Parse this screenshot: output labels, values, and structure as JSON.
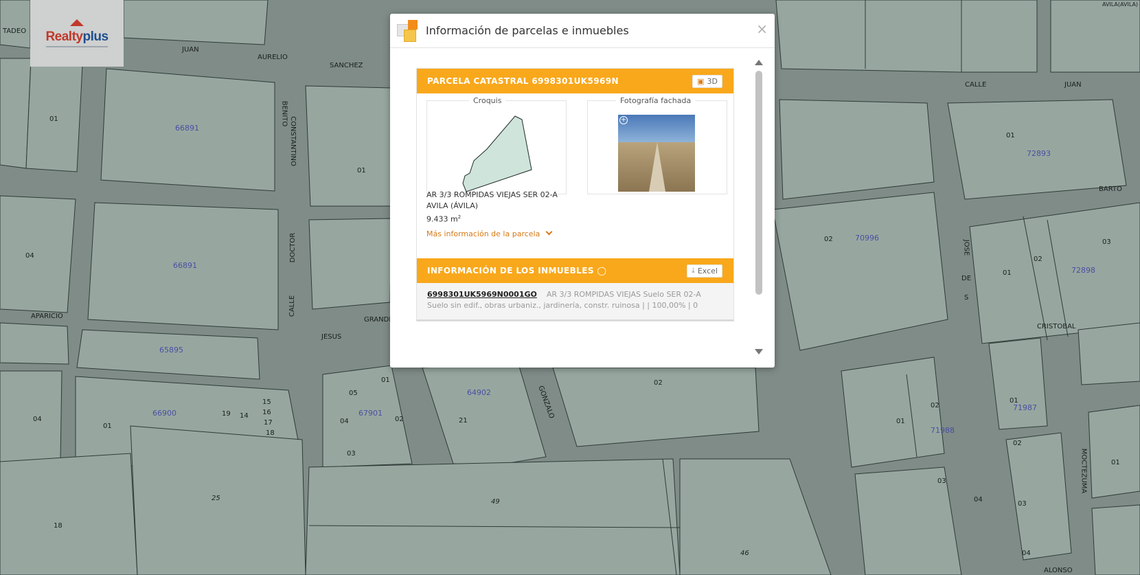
{
  "logo": {
    "brand_part1": "Realty",
    "brand_part2": "plus"
  },
  "map": {
    "streets": [
      "TADEO",
      "JUAN",
      "AURELIO",
      "SANCHEZ",
      "CONSTANTINO",
      "BENITO",
      "DOCTOR",
      "CALLE",
      "APARICIO",
      "JESUS",
      "GRANDE",
      "GONZALO",
      "CALLE",
      "JUAN",
      "BARTO",
      "JOSE",
      "DE",
      "S",
      "CRISTOBAL",
      "MOCTEZUMA",
      "ALONSO",
      "AVILA(AVILA)"
    ],
    "ref_labels": [
      "66891",
      "66891",
      "65895",
      "66900",
      "72893",
      "70996",
      "72898",
      "71987",
      "71988",
      "67901",
      "64902"
    ],
    "plot_labels": [
      "01",
      "04",
      "01",
      "04",
      "01",
      "04",
      "05",
      "03",
      "04",
      "02",
      "01",
      "02",
      "05",
      "25",
      "49",
      "18",
      "46",
      "21",
      "02",
      "03",
      "02",
      "01",
      "02",
      "01",
      "03",
      "01",
      "02",
      "04",
      "03",
      "04",
      "01",
      "02",
      "01",
      "03",
      "15",
      "16",
      "17",
      "18",
      "19",
      "14"
    ]
  },
  "modal": {
    "title": "Información de parcelas e inmuebles",
    "close": "×",
    "parcel": {
      "header": "PARCELA CATASTRAL 6998301UK5969N",
      "btn_3d": "3D",
      "croquis_label": "Croquis",
      "photo_label": "Fotografía fachada",
      "photo_zoom": "+",
      "address_line1": "AR 3/3 ROMPIDAS VIEJAS SER 02-A",
      "address_line2": "AVILA (ÁVILA)",
      "area": "9.433 m",
      "area_unit_sup": "2",
      "more_info": "Más información de la parcela"
    },
    "inmuebles": {
      "header": "INFORMACIÓN DE LOS INMUEBLES",
      "btn_excel": "Excel",
      "rows": [
        {
          "ref": "6998301UK5969N0001GO",
          "desc": "AR 3/3 ROMPIDAS VIEJAS Suelo SER 02-A",
          "detail": "Suelo sin edif., obras urbaniz., jardinería, constr. ruinosa | | 100,00% | 0"
        }
      ]
    }
  }
}
